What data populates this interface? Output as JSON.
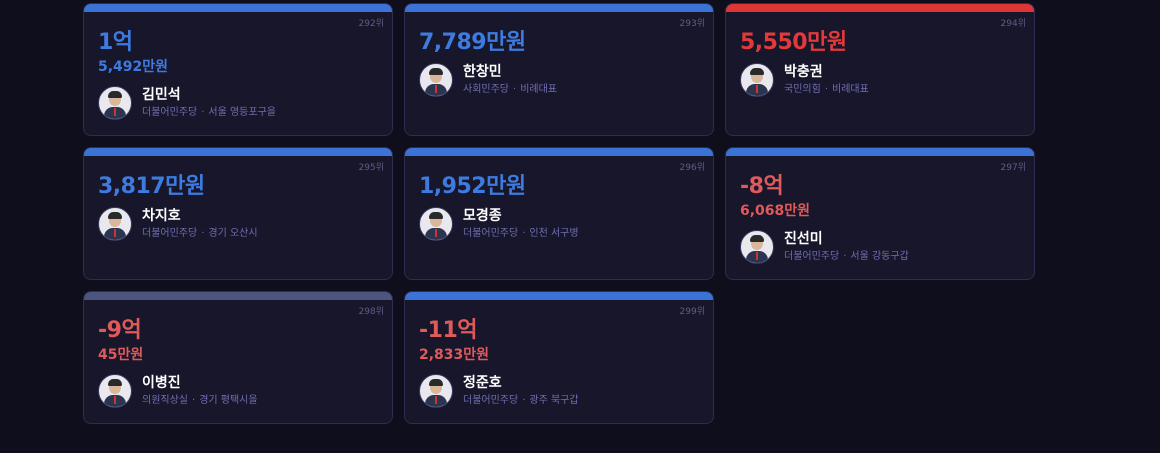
{
  "colors": {
    "positive": "#3e7be0",
    "negative": "#e05a5a",
    "negative_strong": "#e23a3a",
    "bar_blue": "#3b73d6",
    "bar_red": "#e03535",
    "bar_gray": "#4a5680"
  },
  "cards": [
    {
      "rank": "292위",
      "main": "1억",
      "sub": "5,492만원",
      "name": "김민석",
      "party": "더불어민주당",
      "region": "서울 영등포구을",
      "tone": "positive",
      "bar": "bar_blue"
    },
    {
      "rank": "293위",
      "main": "7,789만원",
      "sub": "",
      "name": "한창민",
      "party": "사회민주당",
      "region": "비례대표",
      "tone": "positive",
      "bar": "bar_blue"
    },
    {
      "rank": "294위",
      "main": "5,550만원",
      "sub": "",
      "name": "박충권",
      "party": "국민의힘",
      "region": "비례대표",
      "tone": "negative_strong",
      "bar": "bar_red"
    },
    {
      "rank": "295위",
      "main": "3,817만원",
      "sub": "",
      "name": "차지호",
      "party": "더불어민주당",
      "region": "경기 오산시",
      "tone": "positive",
      "bar": "bar_blue"
    },
    {
      "rank": "296위",
      "main": "1,952만원",
      "sub": "",
      "name": "모경종",
      "party": "더불어민주당",
      "region": "인천 서구병",
      "tone": "positive",
      "bar": "bar_blue"
    },
    {
      "rank": "297위",
      "main": "-8억",
      "sub": "6,068만원",
      "name": "진선미",
      "party": "더불어민주당",
      "region": "서울 강동구갑",
      "tone": "negative",
      "bar": "bar_blue"
    },
    {
      "rank": "298위",
      "main": "-9억",
      "sub": "45만원",
      "name": "이병진",
      "party": "의원직상실",
      "region": "경기 평택시을",
      "tone": "negative",
      "bar": "bar_gray"
    },
    {
      "rank": "299위",
      "main": "-11억",
      "sub": "2,833만원",
      "name": "정준호",
      "party": "더불어민주당",
      "region": "광주 북구갑",
      "tone": "negative",
      "bar": "bar_blue"
    }
  ]
}
